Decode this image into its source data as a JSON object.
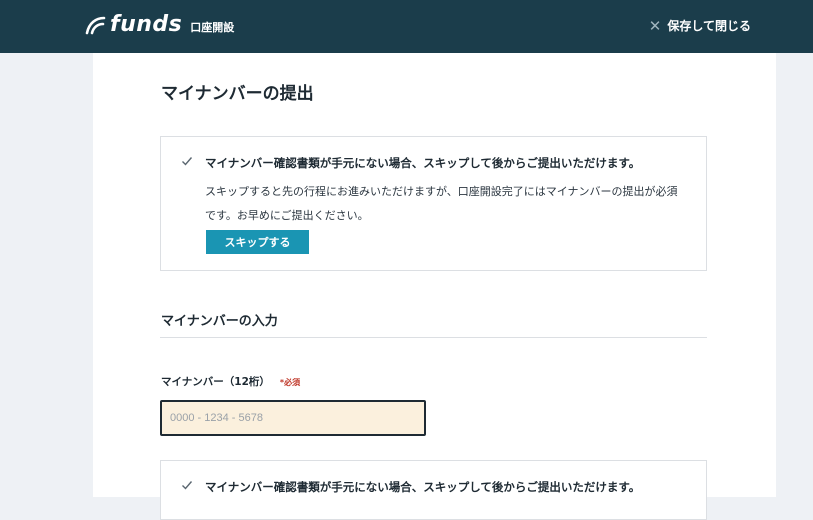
{
  "header": {
    "brand_name": "funds",
    "brand_sub": "口座開設",
    "close_label": "保存して閉じる",
    "close_icon": "close-icon"
  },
  "main": {
    "page_title": "マイナンバーの提出",
    "notice": {
      "headline": "マイナンバー確認書類が手元にない場合、スキップして後からご提出いただけます。",
      "body": "スキップすると先の行程にお進みいただけますが、口座開設完了にはマイナンバーの提出が必須です。お早めにご提出ください。",
      "skip_button": "スキップする"
    },
    "section_title": "マイナンバーの入力",
    "field": {
      "label": "マイナンバー（12桁）",
      "required": "*必須",
      "placeholder": "0000 - 1234 - 5678"
    },
    "notice2": {
      "headline": "マイナンバー確認書類が手元にない場合、スキップして後からご提出いただけます。"
    }
  },
  "colors": {
    "header_bg": "#1b3d4b",
    "accent": "#1a95b3",
    "input_bg": "#fbf0dd",
    "required": "#c0392b"
  }
}
